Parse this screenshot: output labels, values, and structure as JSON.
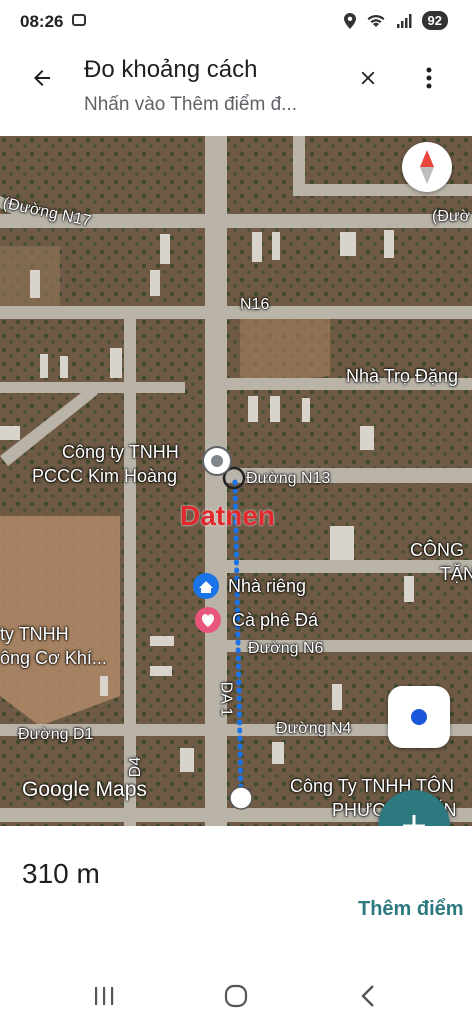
{
  "status": {
    "time": "08:26",
    "battery": "92"
  },
  "header": {
    "title": "Đo khoảng cách",
    "subtitle": "Nhấn vào Thêm điểm đ..."
  },
  "map": {
    "roads": {
      "n17": "(Đường N17",
      "n17_right": "(Đườ",
      "n16": "N16",
      "n13": "Đường N13",
      "n6": "Đường N6",
      "n4": "Đường N4",
      "d1": "Đường D1",
      "d4": "D4",
      "da1": "DA 1"
    },
    "places": {
      "nha_tro": "Nhà Trọ Đặng",
      "cong_ty_line1": "Công ty TNHH",
      "cong_ty_line2": "PCCC Kim Hoàng",
      "cong_right_1": "CÔNG",
      "cong_right_2": "TẶN",
      "nha_rieng": "Nhà riêng",
      "ca_phe": "Cà phê Đá",
      "ty_tnhh": "ty TNHH",
      "ong_co_khi": "ông Cơ Khí...",
      "cong_ty_ton_1": "Công Ty TNHH TÔN",
      "cong_ty_ton_2": "PHƯƠNG YẾN"
    },
    "watermark": "Datnen",
    "google_logo": "Google Maps"
  },
  "measurement": {
    "distance": "310 m",
    "add_point_label": "Thêm điểm"
  },
  "colors": {
    "accent": "#2c7a80",
    "measure_line": "#1a73e8",
    "watermark": "#e0282d"
  }
}
